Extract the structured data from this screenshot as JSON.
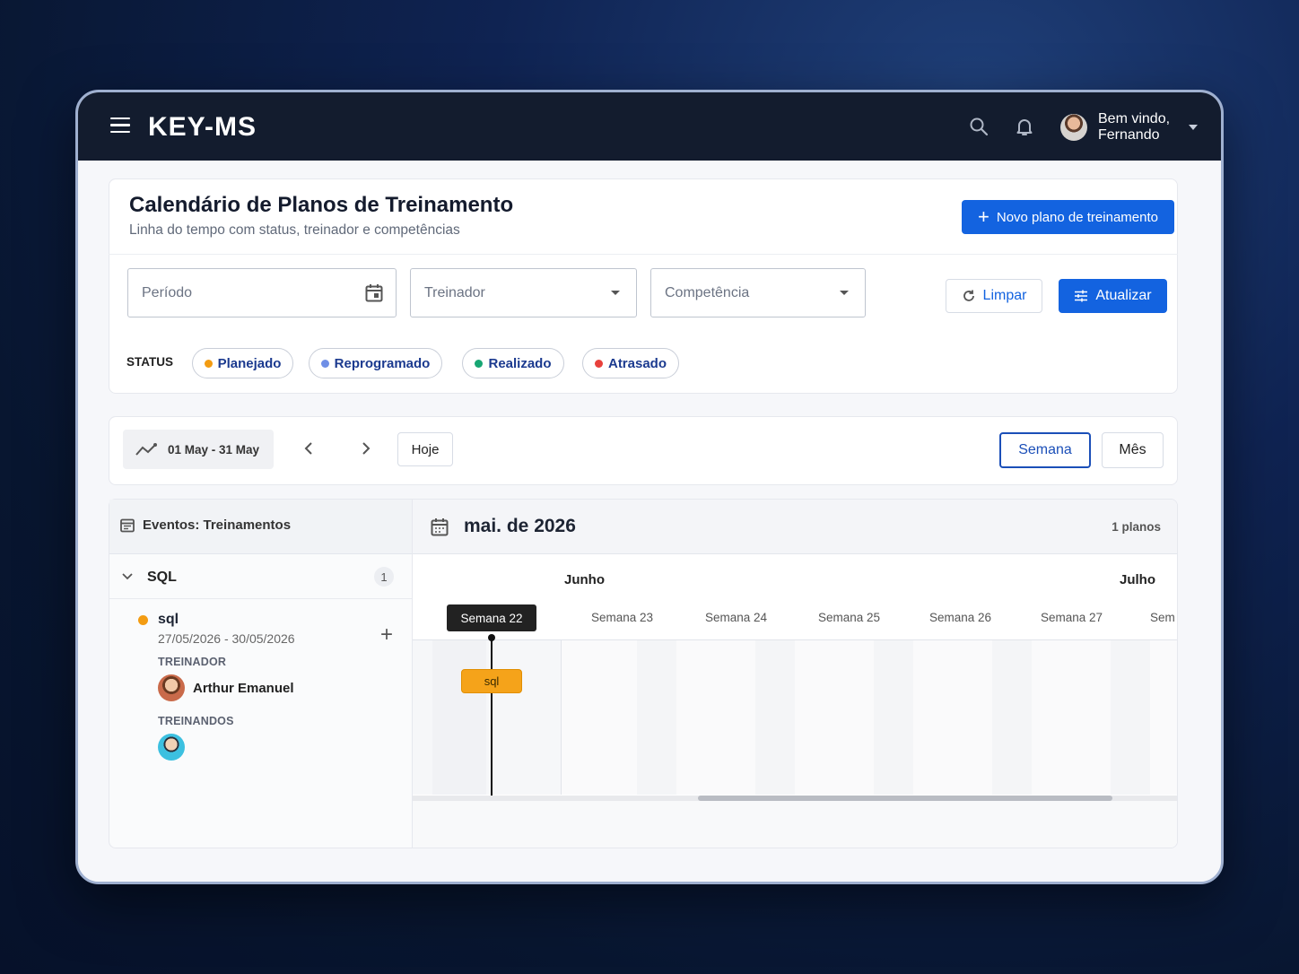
{
  "header": {
    "logo": "KEY-MS",
    "user_greeting_line1": "Bem vindo,",
    "user_greeting_line2": "Fernando"
  },
  "page": {
    "title": "Calendário de Planos de Treinamento",
    "subtitle": "Linha do tempo com status, treinador e competências",
    "new_plan_button": "Novo plano de treinamento"
  },
  "filters": {
    "period_placeholder": "Período",
    "trainer_placeholder": "Treinador",
    "competence_placeholder": "Competência",
    "clear_button": "Limpar",
    "update_button": "Atualizar",
    "status_label": "STATUS",
    "statuses": [
      {
        "label": "Planejado",
        "color": "#f39c12"
      },
      {
        "label": "Reprogramado",
        "color": "#6f8fe6"
      },
      {
        "label": "Realizado",
        "color": "#17a673"
      },
      {
        "label": "Atrasado",
        "color": "#e8413c"
      }
    ]
  },
  "toolbar": {
    "date_range": "01 May - 31 May",
    "today_button": "Hoje",
    "week_button": "Semana",
    "month_button": "Mês"
  },
  "events_panel": {
    "title": "Eventos: Treinamentos",
    "group_name": "SQL",
    "group_count": "1",
    "item": {
      "name": "sql",
      "dates": "27/05/2026 - 30/05/2026",
      "status_color": "#f39c12",
      "trainer_label": "TREINADOR",
      "trainer_name": "Arthur Emanuel",
      "trainees_label": "TREINANDOS"
    }
  },
  "timeline": {
    "month_title": "mai. de 2026",
    "plans_count": "1 planos",
    "months": [
      "Junho",
      "Julho"
    ],
    "weeks": [
      "Semana 22",
      "Semana 23",
      "Semana 24",
      "Semana 25",
      "Semana 26",
      "Semana 27",
      "Sem"
    ],
    "bar_label": "sql",
    "bar_color": "#f5a31a"
  }
}
